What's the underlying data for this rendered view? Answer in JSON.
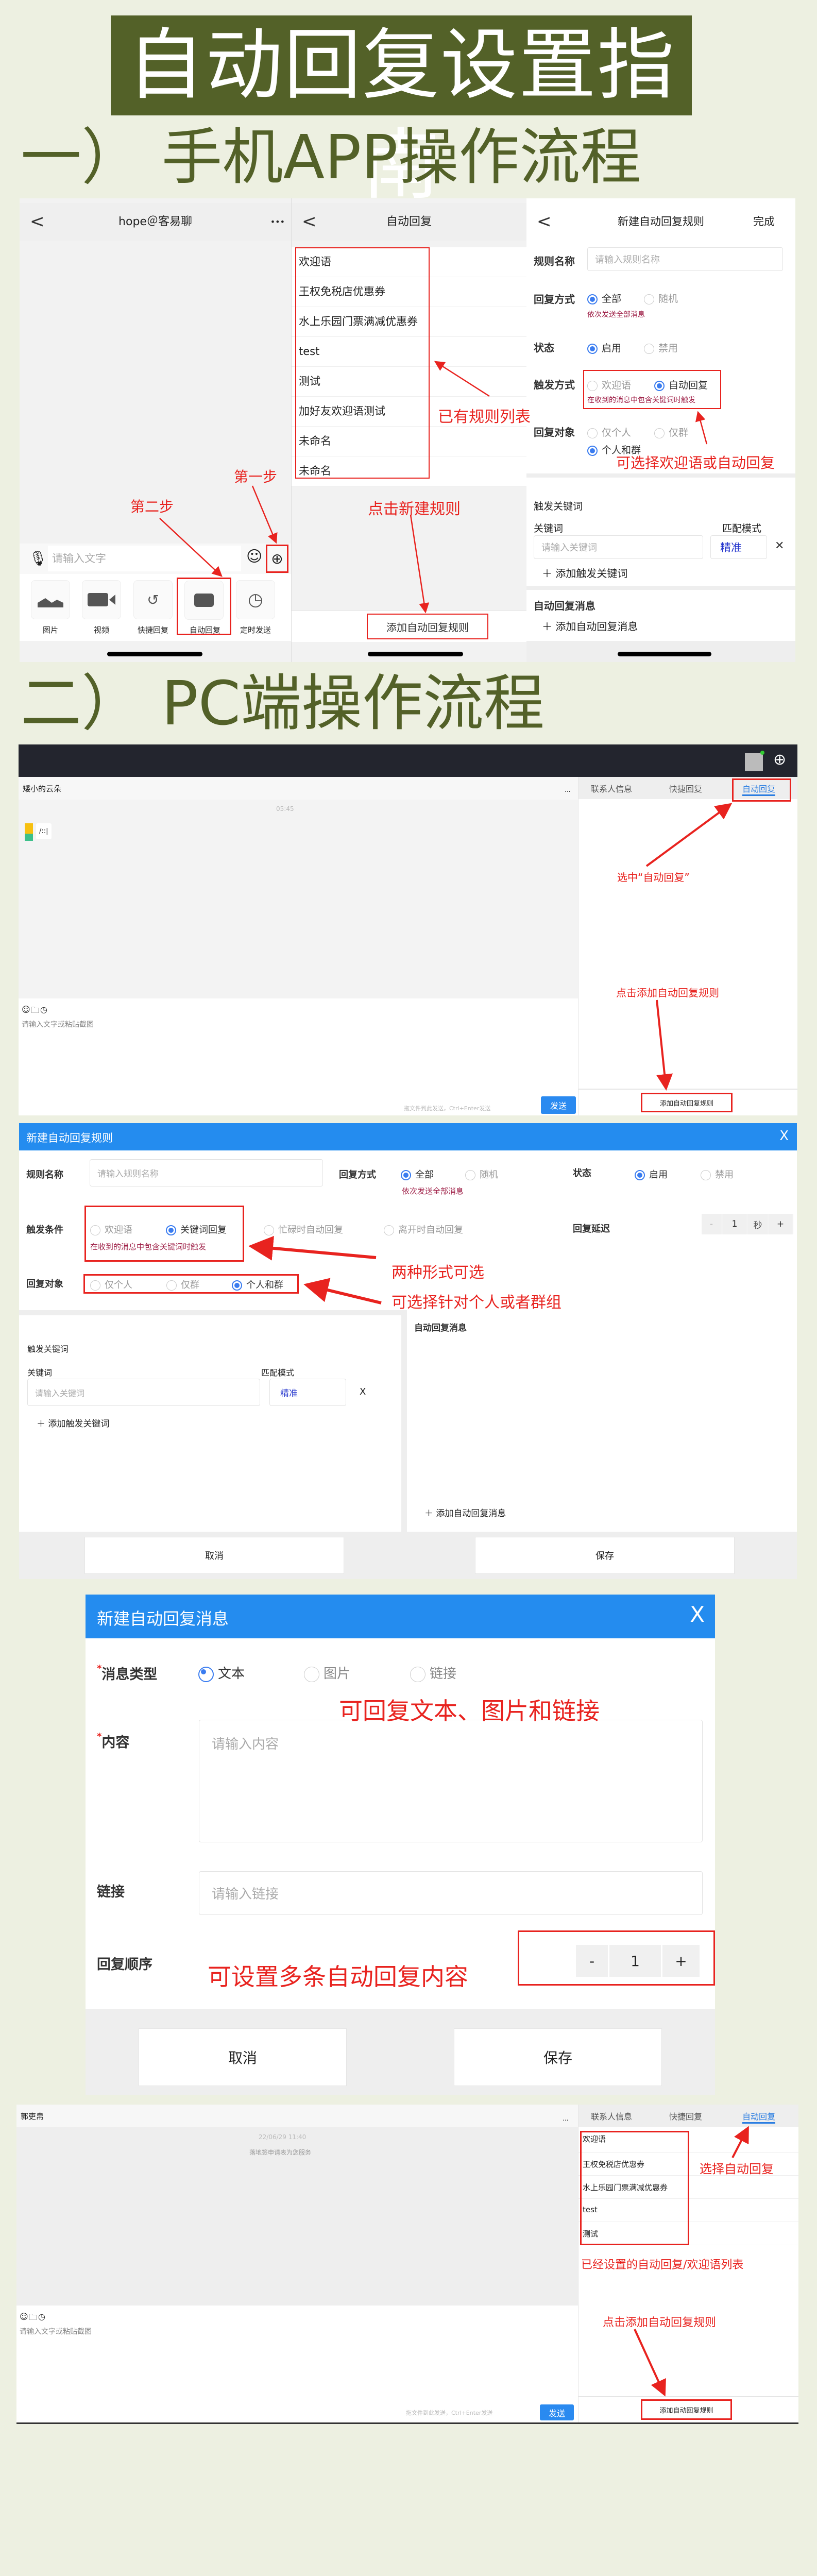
{
  "title": "自动回复设置指南",
  "headings": {
    "mobile": "一）  手机APP操作流程",
    "pc": "二）  PC端操作流程"
  },
  "colors": {
    "accent_green": "#536128",
    "annotation_red": "#e8231f",
    "primary_blue": "#248cef",
    "background": "#edf0e1"
  },
  "phone_chat": {
    "title": "hope＠客易聊",
    "more": "•••",
    "input_placeholder": "请输入文字",
    "tools": [
      "图片",
      "视频",
      "快捷回复",
      "自动回复",
      "定时发送"
    ],
    "annotations": {
      "step1": "第一步",
      "step2": "第二步"
    }
  },
  "phone_list": {
    "title": "自动回复",
    "rules": [
      "欢迎语",
      "王权免税店优惠券",
      "水上乐园门票满减优惠券",
      "test",
      "测试",
      "加好友欢迎语测试",
      "未命名",
      "未命名"
    ],
    "add_button": "添加自动回复规则",
    "annotations": {
      "list": "已有规则列表",
      "new": "点击新建规则"
    }
  },
  "phone_new_rule": {
    "title": "新建自动回复规则",
    "done": "完成",
    "name_label": "规则名称",
    "name_placeholder": "请输入规则名称",
    "reply_mode_label": "回复方式",
    "reply_mode_options": [
      "全部",
      "随机"
    ],
    "reply_mode_hint": "依次发送全部消息",
    "status_label": "状态",
    "status_options": [
      "启用",
      "禁用"
    ],
    "trigger_label": "触发方式",
    "trigger_options": [
      "欢迎语",
      "自动回复"
    ],
    "trigger_hint": "在收到的消息中包含关键词时触发",
    "target_label": "回复对象",
    "target_options": [
      "仅个人",
      "仅群",
      "个人和群"
    ],
    "keywords_section": "触发关键词",
    "keyword_label": "关键词",
    "match_label": "匹配模式",
    "keyword_placeholder": "请输入关键词",
    "match_value": "精准",
    "remove": "✕",
    "add_keyword": "添加触发关键词",
    "messages_section": "自动回复消息",
    "add_message": "添加自动回复消息",
    "annotation": "可选择欢迎语或自动回复"
  },
  "pc_chat": {
    "contact": "矮小的云朵",
    "more": "...",
    "timestamp": "05:45",
    "message": "/::|",
    "input_placeholder": "请输入文字或粘贴截图",
    "send_hint": "拖文件到此发送，Ctrl+Enter发送",
    "send": "发送",
    "tabs": [
      "联系人信息",
      "快捷回复",
      "自动回复"
    ],
    "add_rule": "添加自动回复规则",
    "annotations": {
      "select": "选中“自动回复”",
      "add": "点击添加自动回复规则"
    }
  },
  "pc_new_rule": {
    "title": "新建自动回复规则",
    "close": "X",
    "name_label": "规则名称",
    "name_placeholder": "请输入规则名称",
    "reply_mode_label": "回复方式",
    "reply_mode_options": [
      "全部",
      "随机"
    ],
    "reply_mode_hint": "依次发送全部消息",
    "status_label": "状态",
    "status_options": [
      "启用",
      "禁用"
    ],
    "trigger_label": "触发条件",
    "trigger_options": [
      "欢迎语",
      "关键词回复",
      "忙碌时自动回复",
      "离开时自动回复"
    ],
    "trigger_hint": "在收到的消息中包含关键词时触发",
    "delay_label": "回复延迟",
    "delay_value": "1",
    "delay_unit": "秒",
    "minus": "-",
    "plus": "+",
    "target_label": "回复对象",
    "target_options": [
      "仅个人",
      "仅群",
      "个人和群"
    ],
    "keywords_section": "触发关键词",
    "keyword_label": "关键词",
    "match_label": "匹配模式",
    "keyword_placeholder": "请输入关键词",
    "match_value": "精准",
    "remove": "X",
    "add_keyword": "添加触发关键词",
    "messages_section": "自动回复消息",
    "add_message": "添加自动回复消息",
    "cancel": "取消",
    "save": "保存",
    "annotations": {
      "forms": "两种形式可选",
      "target": "可选择针对个人或者群组"
    }
  },
  "pc_new_message": {
    "title": "新建自动回复消息",
    "close": "X",
    "type_label": "消息类型",
    "type_options": [
      "文本",
      "图片",
      "链接"
    ],
    "content_label": "内容",
    "content_placeholder": "请输入内容",
    "link_label": "链接",
    "link_placeholder": "请输入链接",
    "order_label": "回复顺序",
    "order_value": "1",
    "minus": "-",
    "plus": "+",
    "required": "*",
    "cancel": "取消",
    "save": "保存",
    "annotations": {
      "types": "可回复文本、图片和链接",
      "multi": "可设置多条自动回复内容"
    }
  },
  "pc_rule_list": {
    "contact": "郭吏帛",
    "more": "...",
    "timestamp": "22/06/29 11:40",
    "system_message": "落地签申请表为您服务",
    "input_placeholder": "请输入文字或粘贴截图",
    "send_hint": "拖文件到此发送，Ctrl+Enter发送",
    "send": "发送",
    "tabs": [
      "联系人信息",
      "快捷回复",
      "自动回复"
    ],
    "rules": [
      "欢迎语",
      "王权免税店优惠券",
      "水上乐园门票满减优惠券",
      "test",
      "测试"
    ],
    "add_rule": "添加自动回复规则",
    "annotations": {
      "select": "选择自动回复",
      "list": "已经设置的自动回复/欢迎语列表",
      "add": "点击添加自动回复规则"
    }
  }
}
